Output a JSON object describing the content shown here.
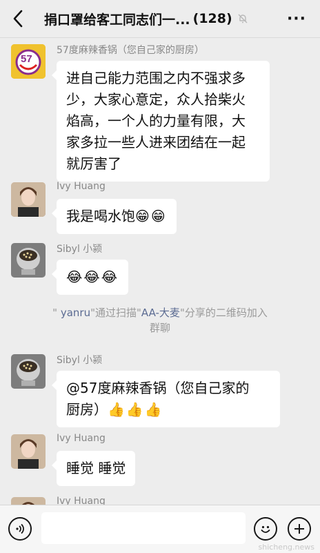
{
  "header": {
    "title": "捐口罩给客工同志们一...",
    "count": "(128)",
    "back_icon": "chevron-left-icon",
    "mute_icon": "bell-muted-icon",
    "more_label": "···"
  },
  "messages": [
    {
      "sender": "57度麻辣香锅（您自己家的厨房）",
      "avatar_text": "57",
      "lines": [
        "进自己能力范围之内不强求多",
        "少，大家心意定，众人拾柴火",
        "焰高，一个人的力量有限，大",
        "家多拉一些人进来团结在一起",
        "就厉害了"
      ]
    },
    {
      "sender": "Ivy Huang",
      "text": "我是喝水饱",
      "emoji": "😁😁"
    },
    {
      "sender": "Sibyl 小颍",
      "emoji": "😂😂😂"
    },
    {
      "sender": "Sibyl 小颍",
      "lines": [
        "@57度麻辣香锅（您自己家的",
        "厨房）"
      ],
      "emoji": "👍👍👍"
    },
    {
      "sender": "Ivy Huang",
      "text": "睡觉 睡觉"
    },
    {
      "sender": "Ivy Huang"
    }
  ],
  "system": {
    "q1": "\"",
    "name1": " yanru",
    "q2": "\"通过扫描\"",
    "name2": "AA-大麦",
    "rest": "\"分享的二维码加入",
    "line2": "群聊"
  },
  "bottom": {
    "voice_icon": "voice-icon",
    "emoji_icon": "smiley-icon",
    "plus_icon": "plus-icon",
    "input_value": ""
  },
  "watermark": "shicheng.news"
}
